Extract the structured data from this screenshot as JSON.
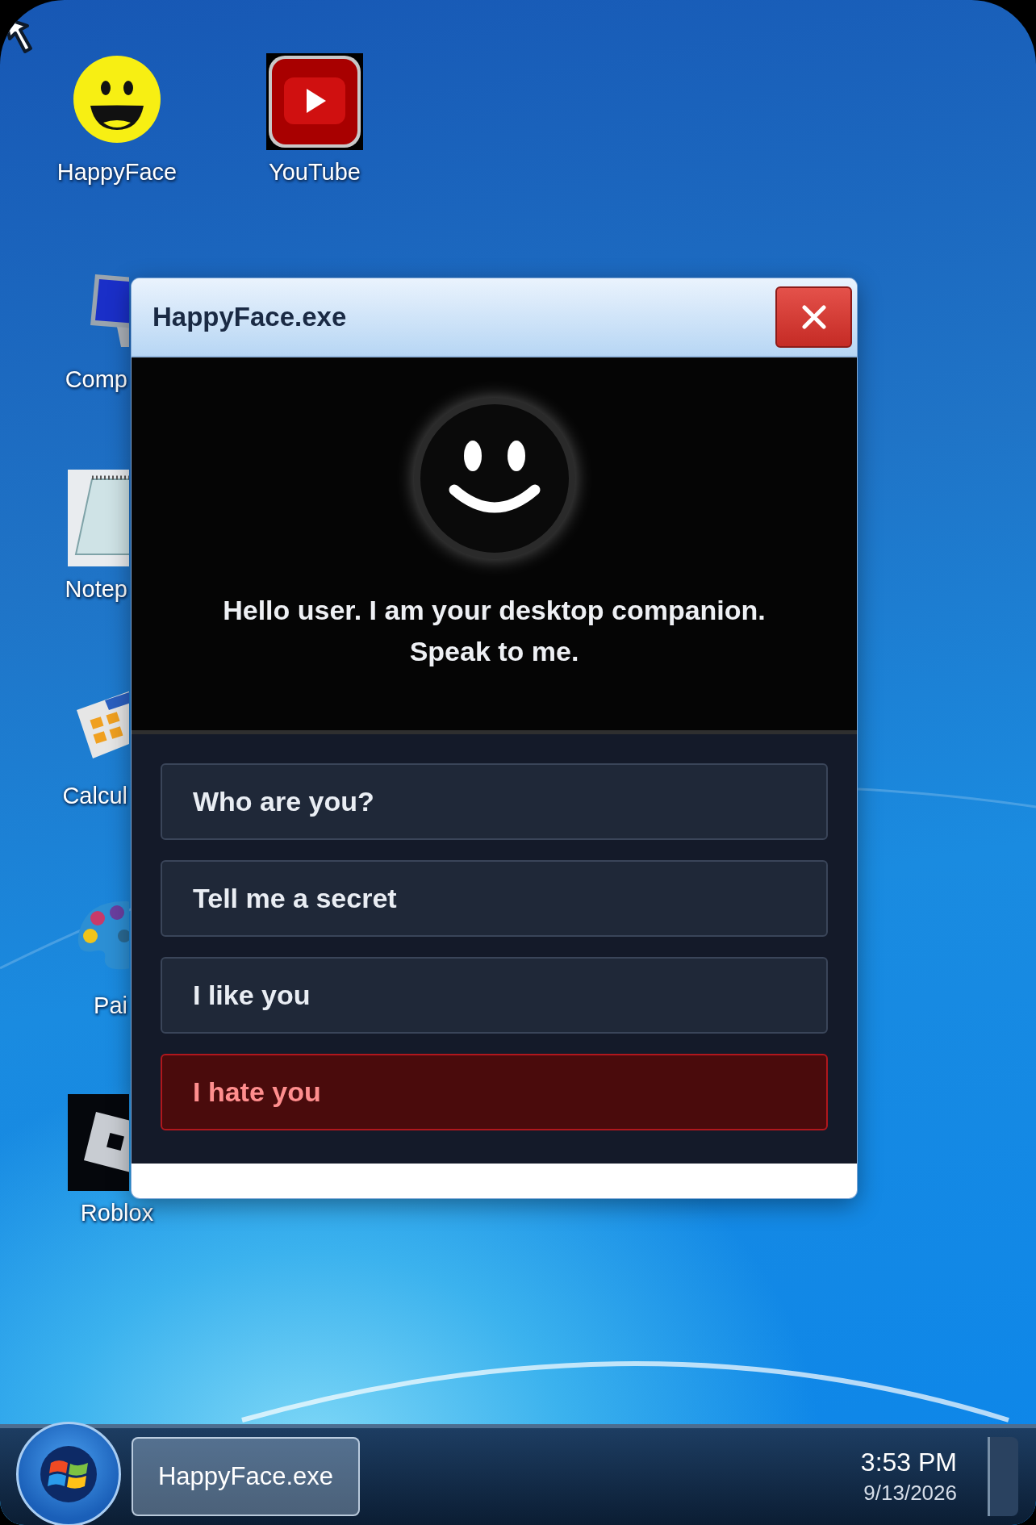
{
  "desktop_icons": [
    {
      "label": "HappyFace",
      "kind": "smiley"
    },
    {
      "label": "YouTube",
      "kind": "video"
    },
    {
      "label": "Comp",
      "kind": "computer"
    },
    {
      "label": "Notep",
      "kind": "notepad"
    },
    {
      "label": "Calcul",
      "kind": "calculator"
    },
    {
      "label": "Pai",
      "kind": "paint"
    },
    {
      "label": "Roblox",
      "kind": "roblox"
    }
  ],
  "window": {
    "title": "HappyFace.exe",
    "message": "Hello user. I am your desktop companion. Speak to me.",
    "choices": [
      {
        "label": "Who are you?",
        "kind": "normal"
      },
      {
        "label": "Tell me a secret",
        "kind": "normal"
      },
      {
        "label": "I like you",
        "kind": "normal"
      },
      {
        "label": "I hate you",
        "kind": "danger"
      }
    ]
  },
  "taskbar": {
    "tasks": [
      {
        "label": "HappyFace.exe"
      }
    ],
    "time": "3:53 PM",
    "date": "9/13/2026"
  }
}
